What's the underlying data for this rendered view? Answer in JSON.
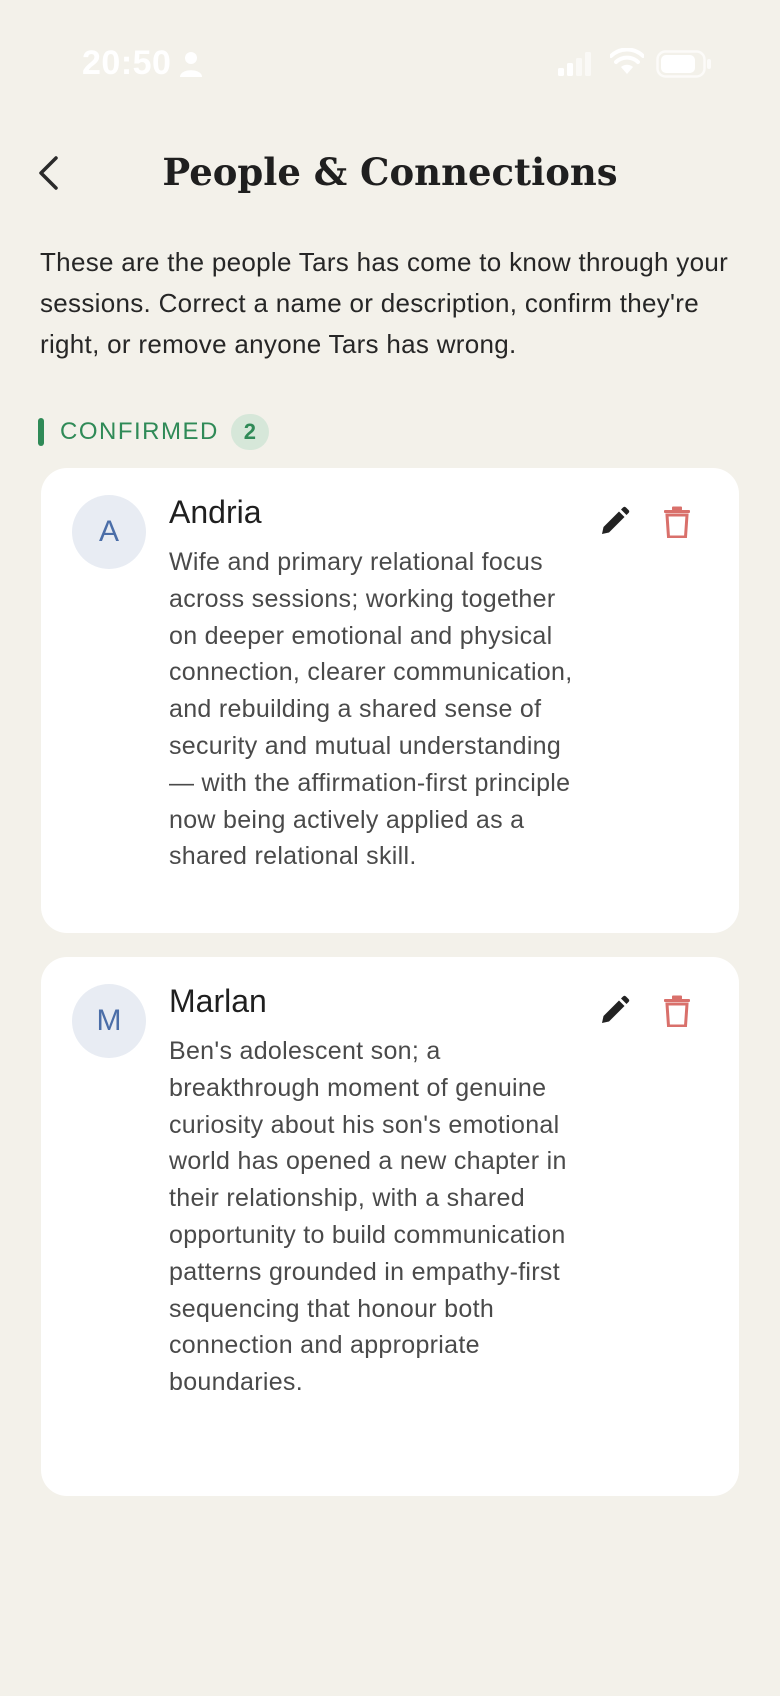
{
  "status_bar": {
    "time": "20:50"
  },
  "header": {
    "title": "People & Connections",
    "back_icon": "chevron-left-icon"
  },
  "intro": {
    "text": "These are the people Tars has come to know through your sessions. Correct a name or description, confirm they're right, or remove anyone Tars has wrong."
  },
  "section": {
    "label": "CONFIRMED",
    "count": "2",
    "accent_color": "#2f8a57"
  },
  "people": [
    {
      "initial": "A",
      "name": "Andria",
      "description": "Wife and primary relational focus across sessions; working together on deeper emotional and physical connection, clearer communication, and rebuilding a shared sense of security and mutual understanding — with the affirmation-first principle now being actively applied as a shared relational skill."
    },
    {
      "initial": "M",
      "name": "Marlan",
      "description": "Ben's adolescent son; a breakthrough moment of genuine curiosity about his son's emotional world has opened a new chapter in their relationship, with a shared opportunity to build communication patterns grounded in empathy-first sequencing that honour both connection and appropriate boundaries."
    }
  ],
  "icons": {
    "edit": "pencil-icon",
    "delete": "trash-icon"
  },
  "colors": {
    "background": "#f3f1ea",
    "delete": "#d9706b",
    "avatar_text": "#4b6ea8"
  }
}
